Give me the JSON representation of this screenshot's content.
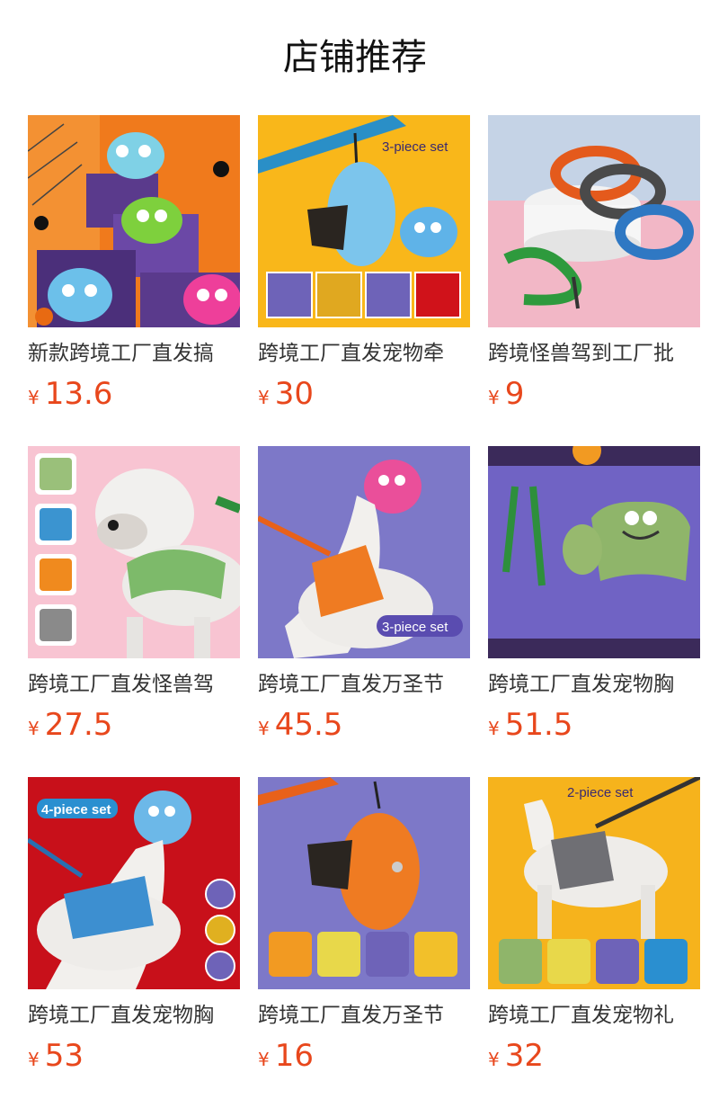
{
  "page": {
    "title": "店铺推荐"
  },
  "products": [
    {
      "name": "新款跨境工厂直发搞",
      "currency": "¥",
      "price": "13.6",
      "image_icon": "monster-toys-halloween-image",
      "bg": "#f07a1c"
    },
    {
      "name": "跨境工厂直发宠物牵",
      "currency": "¥",
      "price": "30",
      "image_icon": "poop-bag-holder-image",
      "bg": "#f9b71a",
      "badge": "3-piece set"
    },
    {
      "name": "跨境怪兽驾到工厂批",
      "currency": "¥",
      "price": "9",
      "image_icon": "dog-leashes-image",
      "bg": "#f2b7c6"
    },
    {
      "name": "跨境工厂直发怪兽驾",
      "currency": "¥",
      "price": "27.5",
      "image_icon": "bulldog-harness-image",
      "bg": "#f8c4d2"
    },
    {
      "name": "跨境工厂直发万圣节",
      "currency": "¥",
      "price": "45.5",
      "image_icon": "orange-harness-set-image",
      "bg": "#7d78c8",
      "badge": "3-piece set"
    },
    {
      "name": "跨境工厂直发宠物胸",
      "currency": "¥",
      "price": "51.5",
      "image_icon": "green-harness-set-image",
      "bg": "#7063c4"
    },
    {
      "name": "跨境工厂直发宠物胸",
      "currency": "¥",
      "price": "53",
      "image_icon": "blue-harness-set-image",
      "bg": "#c8101a",
      "badge": "4-piece set"
    },
    {
      "name": "跨境工厂直发万圣节",
      "currency": "¥",
      "price": "16",
      "image_icon": "orange-poop-bag-image",
      "bg": "#7d78c8"
    },
    {
      "name": "跨境工厂直发宠物礼",
      "currency": "¥",
      "price": "32",
      "image_icon": "grey-harness-set-image",
      "bg": "#f6b31c",
      "badge": "2-piece set"
    }
  ]
}
